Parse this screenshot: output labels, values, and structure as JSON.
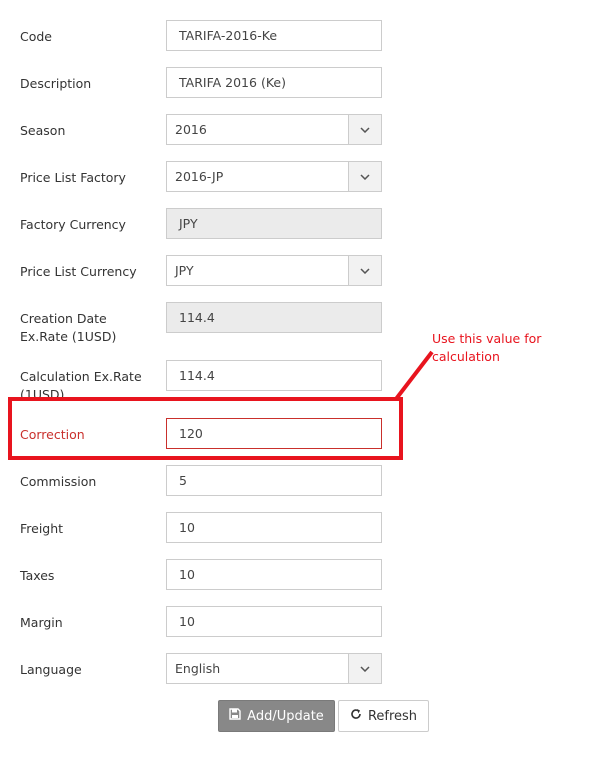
{
  "form": {
    "code": {
      "label": "Code",
      "value": "TARIFA-2016-Ke"
    },
    "description": {
      "label": "Description",
      "value": "TARIFA 2016 (Ke)"
    },
    "season": {
      "label": "Season",
      "value": "2016"
    },
    "price_list_factory": {
      "label": "Price List Factory",
      "value": "2016-JP"
    },
    "factory_currency": {
      "label": "Factory Currency",
      "value": "JPY"
    },
    "price_list_currency": {
      "label": "Price List Currency",
      "value": "JPY"
    },
    "creation_rate": {
      "label": "Creation Date Ex.Rate (1USD)",
      "value": "114.4"
    },
    "calculation_rate": {
      "label": "Calculation Ex.Rate (1USD)",
      "value": "114.4"
    },
    "correction": {
      "label": "Correction",
      "value": "120"
    },
    "commission": {
      "label": "Commission",
      "value": "5"
    },
    "freight": {
      "label": "Freight",
      "value": "10"
    },
    "taxes": {
      "label": "Taxes",
      "value": "10"
    },
    "margin": {
      "label": "Margin",
      "value": "10"
    },
    "language": {
      "label": "Language",
      "value": "English"
    }
  },
  "buttons": {
    "add_update": "Add/Update",
    "refresh": "Refresh"
  },
  "annotation": {
    "text": "Use this value for calculation",
    "color": "#e8141e"
  },
  "colors": {
    "error": "#c9302c",
    "primary_button": "#888888",
    "readonly_bg": "#ebebeb"
  }
}
